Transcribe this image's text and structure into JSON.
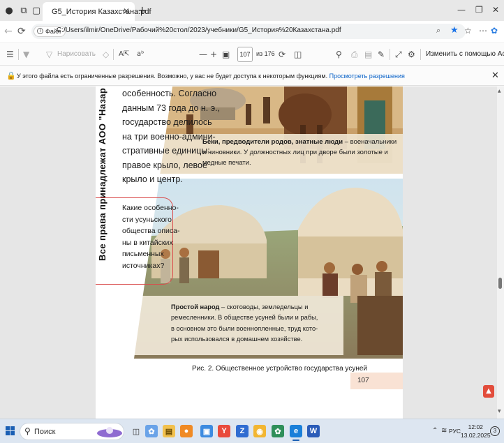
{
  "browser": {
    "tab_title": "G5_История Казахстана.pdf",
    "file_chip": "Файл",
    "url": "C:/Users/ilmir/OneDrive/Рабочий%20стол/2023/учебники/G5_История%20Казахстана.pdf"
  },
  "pdf_toolbar": {
    "draw_label": "Нарисовать",
    "read_aloud": "Aᵃ",
    "page_number": "107",
    "page_of": "из 176",
    "acrobat_label": "Изменить с помощью Acrobat"
  },
  "info_bar": {
    "message": "У этого файла есть ограниченные разрешения. Возможно, у вас не будет доступа к некоторым функциям.",
    "link": "Просмотреть разрешения"
  },
  "page": {
    "vertical_text": "Все права принадлежат АОО \"Назар",
    "body_lines": [
      "особенность. Согласно",
      "данным 73 года до н. э.,",
      "государство делилось",
      "на три военно-админи-",
      "стративные единицы:",
      "правое крыло, левое",
      "крыло и центр."
    ],
    "question_lines": [
      "Какие особенно-",
      "сти усуньского",
      "общества описа-",
      "ны в китайских",
      "письменных",
      "источниках?"
    ],
    "caption_top_bold": "Беки, предводители родов, знатные люди",
    "caption_top_rest": " – военачальники и чиновники. У должностных лиц при дворе были золотые и медные печати.",
    "caption_bottom_bold": "Простой народ",
    "caption_bottom_rest": " – скотоводы, земледельцы и ремесленники. В обществе усуней были и рабы, в основном это были военнопленные, труд кото-рых использовался в домашнем хозяйстве.",
    "figure_caption": "Рис. 2. Общественное устройство государства усуней",
    "page_number": "107"
  },
  "taskbar": {
    "search_label": "Поиск",
    "language": "РУС",
    "time": "12:02",
    "date": "13.02.2025",
    "notifications": "3"
  },
  "colors": {
    "accent": "#1a73e8",
    "link": "#0b63c8",
    "question_border": "#d94b4b",
    "page_num_bg": "#f9e2d4"
  }
}
